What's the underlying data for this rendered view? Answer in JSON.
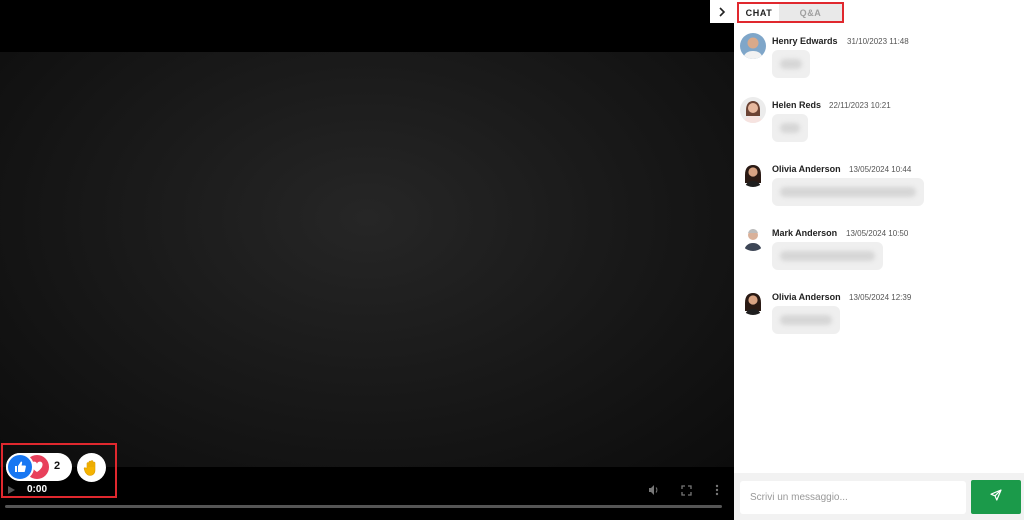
{
  "player": {
    "time": "0:00",
    "icons": [
      "play-icon",
      "volume-icon",
      "fullscreen-icon",
      "more-vertical-icon"
    ]
  },
  "reactions": {
    "count": "2",
    "icons": [
      "like-icon",
      "heart-icon",
      "raise-hand-icon"
    ],
    "colors": {
      "like": "#1877f2",
      "heart": "#e8405b",
      "hand": "#f5b300"
    }
  },
  "panel": {
    "collapse_icon": "chevron-right-icon",
    "tabs": [
      {
        "label": "CHAT",
        "active": true
      },
      {
        "label": "Q&A",
        "active": false
      }
    ]
  },
  "chat": {
    "messages": [
      {
        "name": "Henry Edwards",
        "time": "31/10/2023 11:48"
      },
      {
        "name": "Helen Reds",
        "time": "22/11/2023 10:21"
      },
      {
        "name": "Olivia Anderson",
        "time": "13/05/2024 10:44"
      },
      {
        "name": "Mark Anderson",
        "time": "13/05/2024 10:50"
      },
      {
        "name": "Olivia Anderson",
        "time": "13/05/2024 12:39"
      }
    ]
  },
  "composer": {
    "placeholder": "Scrivi un messaggio...",
    "send_icon": "send-icon",
    "accent": "#1b9a4a"
  }
}
